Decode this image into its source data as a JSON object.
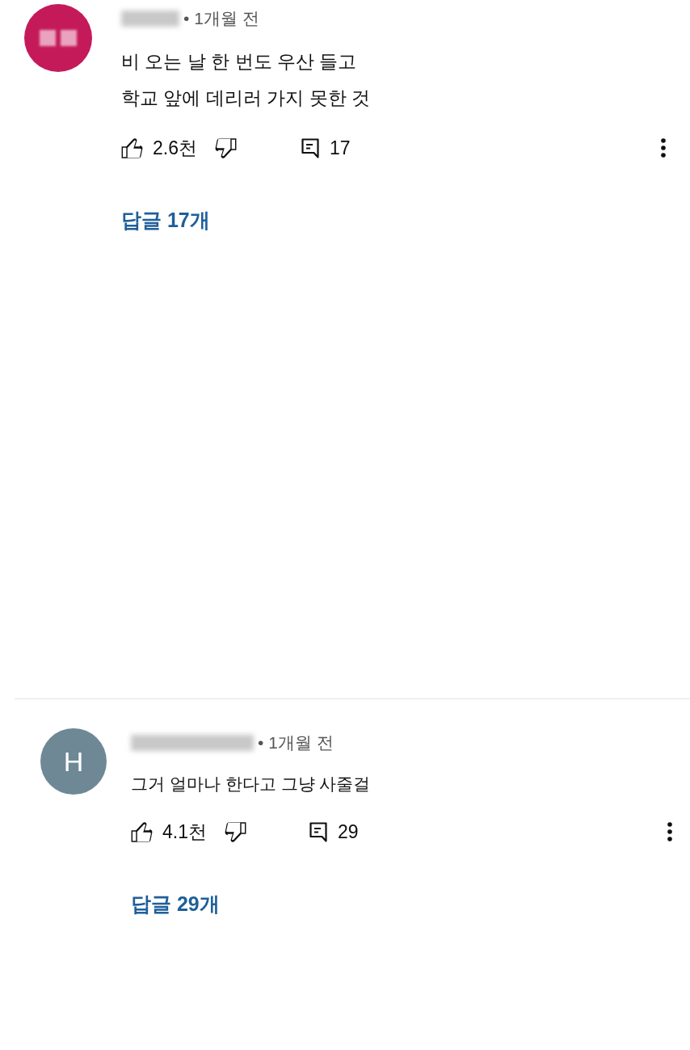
{
  "comments": [
    {
      "avatar": {
        "kind": "blurred",
        "color": "#c41a5a"
      },
      "author": {
        "blurred": true
      },
      "time": "• 1개월 전",
      "text": "비 오는 날 한 번도 우산 들고\n학교 앞에 데리러 가지 못한 것",
      "likes": "2.6천",
      "reply_count": "17",
      "replies_link": "답글 17개"
    },
    {
      "avatar": {
        "kind": "letter",
        "letter": "H",
        "color": "#6e8896"
      },
      "author": {
        "blurred": true
      },
      "time": "• 1개월 전",
      "text": "그거 얼마나 한다고 그냥 사줄걸",
      "likes": "4.1천",
      "reply_count": "29",
      "replies_link": "답글 29개"
    }
  ]
}
